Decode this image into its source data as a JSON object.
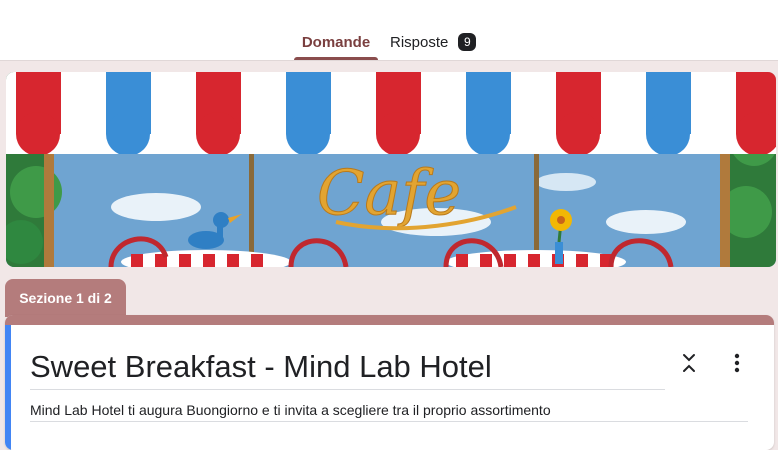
{
  "tabs": {
    "questions_label": "Domande",
    "responses_label": "Risposte",
    "responses_count": "9"
  },
  "header_image": {
    "sign_text": "Cafe"
  },
  "section": {
    "label": "Sezione 1 di 2"
  },
  "form": {
    "title": "Sweet Breakfast - Mind Lab Hotel",
    "description": "Mind Lab Hotel ti augura Buongiorno e ti invita a scegliere tra il proprio assortimento"
  },
  "icons": {
    "collapse": "collapse-icon",
    "more": "more-vert-icon"
  },
  "colors": {
    "accent": "#8a4d4d",
    "section_bar": "#b47c7c",
    "left_bar": "#4285f4",
    "background": "#f1e7e7"
  }
}
